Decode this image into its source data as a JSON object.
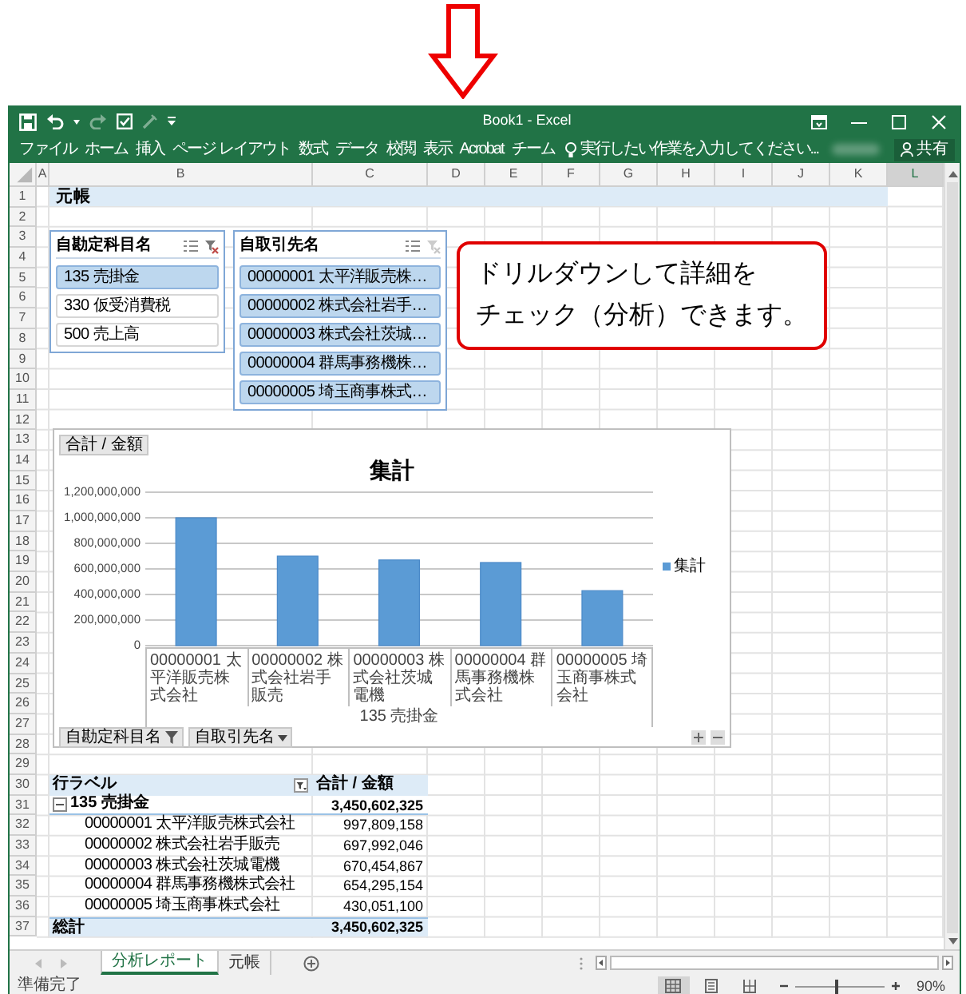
{
  "window": {
    "title": "Book1 - Excel"
  },
  "ribbon_tabs": [
    "ファイル",
    "ホーム",
    "挿入",
    "ページ レイアウト",
    "数式",
    "データ",
    "校閲",
    "表示",
    "Acrobat",
    "チーム"
  ],
  "tell_me": {
    "placeholder": "実行したい作業を入力してください..."
  },
  "share_button": "共有",
  "columns": [
    {
      "label": "A",
      "selected": false
    },
    {
      "label": "B",
      "selected": false
    },
    {
      "label": "C",
      "selected": false
    },
    {
      "label": "D",
      "selected": false
    },
    {
      "label": "E",
      "selected": false
    },
    {
      "label": "F",
      "selected": false
    },
    {
      "label": "G",
      "selected": false
    },
    {
      "label": "H",
      "selected": false
    },
    {
      "label": "I",
      "selected": false
    },
    {
      "label": "J",
      "selected": false
    },
    {
      "label": "K",
      "selected": false
    },
    {
      "label": "L",
      "selected": true
    }
  ],
  "rows": [
    "1",
    "2",
    "3",
    "4",
    "5",
    "6",
    "7",
    "8",
    "9",
    "10",
    "11",
    "12",
    "13",
    "14",
    "15",
    "16",
    "17",
    "18",
    "19",
    "20",
    "21",
    "22",
    "23",
    "24",
    "25",
    "26",
    "27",
    "28",
    "29",
    "30",
    "31",
    "32",
    "33",
    "34",
    "35",
    "36",
    "37"
  ],
  "sheet_title": "元帳",
  "slicers": [
    {
      "title": "自勘定科目名",
      "clear_filter_enabled": true,
      "items": [
        {
          "label": "135 売掛金",
          "selected": true
        },
        {
          "label": "330 仮受消費税",
          "selected": false
        },
        {
          "label": "500 売上高",
          "selected": false
        }
      ]
    },
    {
      "title": "自取引先名",
      "clear_filter_enabled": false,
      "items": [
        {
          "label": "00000001 太平洋販売株…",
          "selected": true
        },
        {
          "label": "00000002 株式会社岩手…",
          "selected": true
        },
        {
          "label": "00000003 株式会社茨城…",
          "selected": true
        },
        {
          "label": "00000004 群馬事務機株…",
          "selected": true
        },
        {
          "label": "00000005 埼玉商事株式…",
          "selected": true
        }
      ]
    }
  ],
  "callout": [
    "ドリルダウンして詳細を",
    "チェック（分析）できます。"
  ],
  "chart": {
    "value_field_button": "合計 / 金額",
    "axis_field_buttons": [
      {
        "label": "自勘定科目名",
        "filtered": true
      },
      {
        "label": "自取引先名",
        "filtered": false
      }
    ],
    "group_label": "135 売掛金",
    "chart_data": {
      "type": "bar",
      "title": "集計",
      "categories": [
        "00000001 太平洋販売株式会社",
        "00000002 株式会社岩手販売",
        "00000003 株式会社茨城電機",
        "00000004 群馬事務機株式会社",
        "00000005 埼玉商事株式会社"
      ],
      "series": [
        {
          "name": "集計",
          "color": "#5b9bd5",
          "values": [
            1000000000,
            700000000,
            670000000,
            650000000,
            430000000
          ]
        }
      ],
      "grid": true,
      "ylim": [
        0,
        1200000000
      ],
      "yticks": [
        {
          "value": 0,
          "label": "0"
        },
        {
          "value": 200000000,
          "label": "200,000,000"
        },
        {
          "value": 400000000,
          "label": "400,000,000"
        },
        {
          "value": 600000000,
          "label": "600,000,000"
        },
        {
          "value": 800000000,
          "label": "800,000,000"
        },
        {
          "value": 1000000000,
          "label": "1,000,000,000"
        },
        {
          "value": 1200000000,
          "label": "1,200,000,000"
        }
      ]
    }
  },
  "pivot": {
    "header": [
      "行ラベル",
      "合計 / 金額"
    ],
    "group": {
      "label": "135 売掛金",
      "expanded": true,
      "value": "3,450,602,325"
    },
    "rows": [
      {
        "label": "00000001 太平洋販売株式会社",
        "value": "997,809,158"
      },
      {
        "label": "00000002 株式会社岩手販売",
        "value": "697,992,046"
      },
      {
        "label": "00000003 株式会社茨城電機",
        "value": "670,454,867"
      },
      {
        "label": "00000004 群馬事務機株式会社",
        "value": "654,295,154"
      },
      {
        "label": "00000005 埼玉商事株式会社",
        "value": "430,051,100"
      }
    ],
    "grand_total": {
      "label": "総計",
      "value": "3,450,602,325"
    }
  },
  "sheet_tabs": [
    {
      "label": "分析レポート",
      "selected": true
    },
    {
      "label": "元帳",
      "selected": false
    }
  ],
  "status": "準備完了",
  "views": [
    {
      "kind": "normal",
      "selected": true
    },
    {
      "kind": "page_layout",
      "selected": false
    },
    {
      "kind": "page_break",
      "selected": false
    }
  ],
  "zoom": {
    "level": 0.47,
    "reading": "90%"
  }
}
